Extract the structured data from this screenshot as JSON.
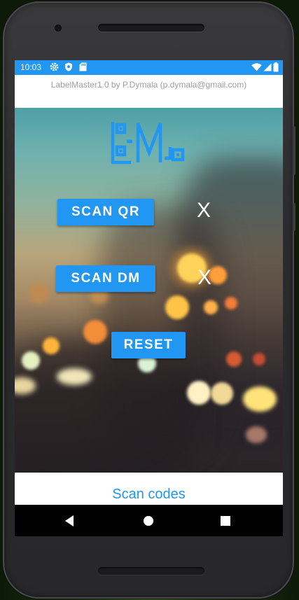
{
  "status_bar": {
    "time": "10:03",
    "left_icons": [
      "gear-icon",
      "shield-icon",
      "sd-card-icon"
    ],
    "right_icons": [
      "wifi-icon",
      "signal-icon",
      "battery-icon"
    ]
  },
  "app": {
    "title": "LabelMaster1.0 by P.Dymala (p.dymala@gmail.com)",
    "logo_text": "LM",
    "buttons": {
      "scan_qr": "SCAN QR",
      "scan_dm": "SCAN DM",
      "reset": "RESET"
    },
    "qr_status": "X",
    "dm_status": "X",
    "bottom_label": "Scan codes"
  },
  "nav": [
    "back-icon",
    "home-icon",
    "recents-icon"
  ],
  "colors": {
    "accent": "#2196f3",
    "status_bar": "#2196f3",
    "title_text": "#9e9e9e",
    "bottom_label": "#2196f3"
  }
}
